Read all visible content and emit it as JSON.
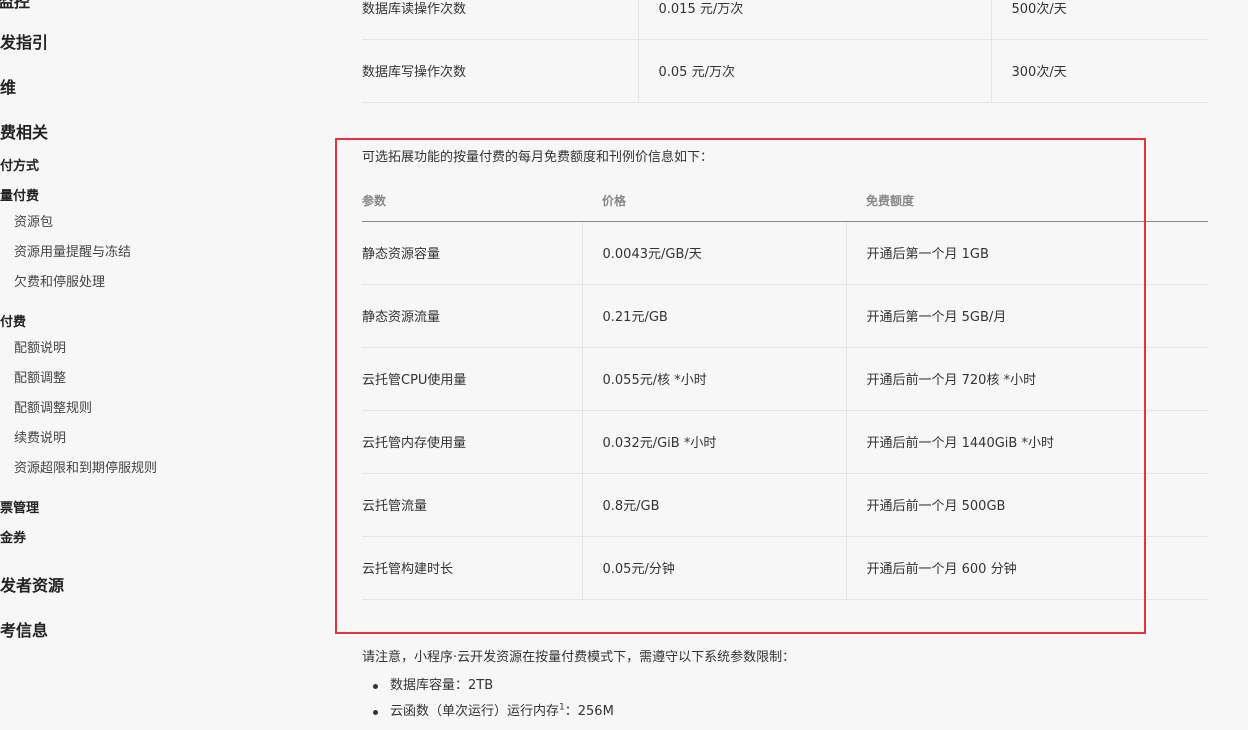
{
  "sidebar": {
    "items": [
      {
        "label": "运维监控",
        "level": 1
      },
      {
        "label": "开发指引",
        "level": 1
      },
      {
        "label": "运维",
        "level": 1
      },
      {
        "label": "计费相关",
        "level": 1
      },
      {
        "label": "支付方式",
        "level": 2
      },
      {
        "label": "按量付费",
        "level": 2
      },
      {
        "label": "资源包",
        "level": 3
      },
      {
        "label": "资源用量提醒与冻结",
        "level": 3
      },
      {
        "label": "欠费和停服处理",
        "level": 3
      },
      {
        "label": "预付费",
        "level": 2
      },
      {
        "label": "配额说明",
        "level": 3
      },
      {
        "label": "配额调整",
        "level": 3
      },
      {
        "label": "配额调整规则",
        "level": 3
      },
      {
        "label": "续费说明",
        "level": 3
      },
      {
        "label": "资源超限和到期停服规则",
        "level": 3
      },
      {
        "label": "发票管理",
        "level": 2
      },
      {
        "label": "代金券",
        "level": 2
      },
      {
        "label": "开发者资源",
        "level": 1
      },
      {
        "label": "参考信息",
        "level": 1
      }
    ]
  },
  "top_table": {
    "rows": [
      [
        "数据库读操作次数",
        "0.015 元/万次",
        "500次/天"
      ],
      [
        "数据库写操作次数",
        "0.05 元/万次",
        "300次/天"
      ]
    ]
  },
  "ext": {
    "intro": "可选拓展功能的按量付费的每月免费额度和刊例价信息如下：",
    "headers": [
      "参数",
      "价格",
      "免费额度"
    ],
    "rows": [
      [
        "静态资源容量",
        "0.0043元/GB/天",
        "开通后第一个月 1GB"
      ],
      [
        "静态资源流量",
        "0.21元/GB",
        "开通后第一个月 5GB/月"
      ],
      [
        "云托管CPU使用量",
        "0.055元/核 *小时",
        "开通后前一个月 720核 *小时"
      ],
      [
        "云托管内存使用量",
        "0.032元/GiB *小时",
        "开通后前一个月 1440GiB *小时"
      ],
      [
        "云托管流量",
        "0.8元/GB",
        "开通后前一个月 500GB"
      ],
      [
        "云托管构建时长",
        "0.05元/分钟",
        "开通后前一个月 600 分钟"
      ]
    ]
  },
  "note": "请注意，小程序·云开发资源在按量付费模式下，需遵守以下系统参数限制：",
  "limits": [
    {
      "text": "数据库容量：2TB"
    },
    {
      "pre": "云函数（单次运行）运行内存",
      "sup": "1",
      "post": "：256M"
    }
  ],
  "colors": {
    "highlight": "#e5323c",
    "background": "#f7f7f7"
  }
}
